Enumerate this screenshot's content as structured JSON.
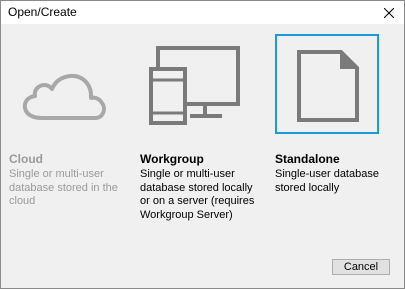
{
  "window": {
    "title": "Open/Create"
  },
  "options": [
    {
      "title": "Cloud",
      "description": "Single or multi-user database stored in the cloud",
      "icon": "cloud-icon",
      "state": "disabled"
    },
    {
      "title": "Workgroup",
      "description": "Single or multi-user database stored locally or on a server (requires Workgroup Server)",
      "icon": "devices-icon",
      "state": "enabled"
    },
    {
      "title": "Standalone",
      "description": "Single-user database stored locally",
      "icon": "document-icon",
      "state": "selected"
    }
  ],
  "footer": {
    "cancel_label": "Cancel"
  },
  "colors": {
    "selection_border": "#1a9ad6",
    "icon_gray": "#7a7a7a",
    "icon_disabled": "#a8a8a8"
  }
}
